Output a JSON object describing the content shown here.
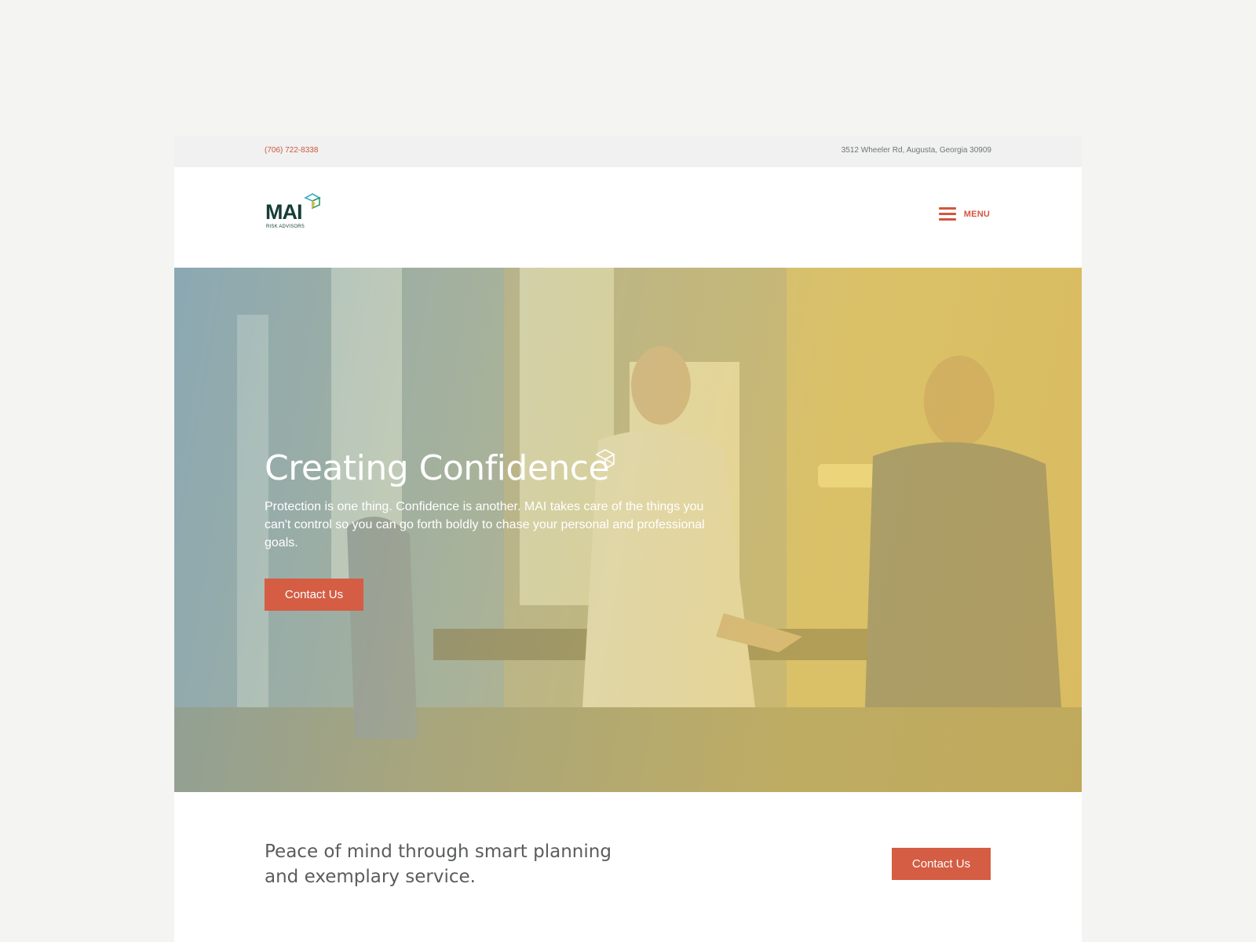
{
  "topbar": {
    "phone": "(706) 722-8338",
    "address": "3512 Wheeler Rd, Augusta, Georgia 30909"
  },
  "header": {
    "logo_text": "MAI",
    "logo_tagline": "RISK ADVISORS",
    "menu_label": "MENU"
  },
  "hero": {
    "title": "Creating Confidence",
    "body": "Protection is one thing. Confidence is another. MAI takes care of the things you can't control so you can go forth boldly to chase your personal and professional goals.",
    "cta_label": "Contact Us"
  },
  "intro": {
    "text": "Peace of mind through smart planning and exemplary service.",
    "cta_label": "Contact Us"
  },
  "colors": {
    "accent": "#d45d44",
    "brand_dark": "#173d36",
    "background": "#f4f4f3"
  },
  "icons": {
    "menu": "hamburger-icon",
    "logo_mark": "cube-icon"
  }
}
